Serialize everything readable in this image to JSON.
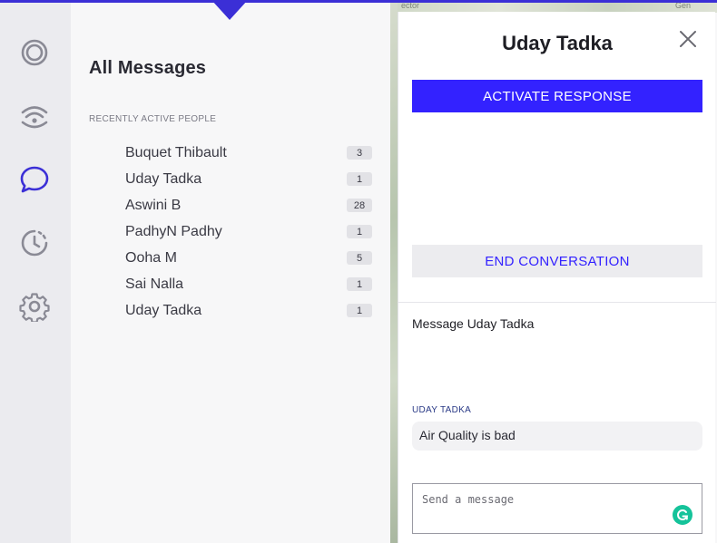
{
  "sidebar": {
    "icons": [
      "target-icon",
      "broadcast-icon",
      "chat-icon",
      "history-icon",
      "gear-icon"
    ],
    "active_index": 2,
    "active_color": "#3b2fd6",
    "inactive_color": "#8a8a95"
  },
  "messages": {
    "title": "All Messages",
    "section_label": "RECENTLY ACTIVE PEOPLE",
    "people": [
      {
        "name": "Buquet Thibault",
        "count": "3"
      },
      {
        "name": "Uday Tadka",
        "count": "1"
      },
      {
        "name": "Aswini B",
        "count": "28"
      },
      {
        "name": "PadhyN Padhy",
        "count": "1"
      },
      {
        "name": "Ooha M",
        "count": "5"
      },
      {
        "name": "Sai Nalla",
        "count": "1"
      },
      {
        "name": "Uday Tadka",
        "count": "1"
      }
    ]
  },
  "map": {
    "label_left": "ector",
    "label_right": "Gen"
  },
  "conversation": {
    "title": "Uday Tadka",
    "activate_label": "ACTIVATE RESPONSE",
    "end_label": "END CONVERSATION",
    "message_heading": "Message Uday Tadka",
    "sender_label": "UDAY TADKA",
    "last_message": "Air Quality is bad",
    "composer_placeholder": "Send a message",
    "primary_color": "#3322ff"
  }
}
